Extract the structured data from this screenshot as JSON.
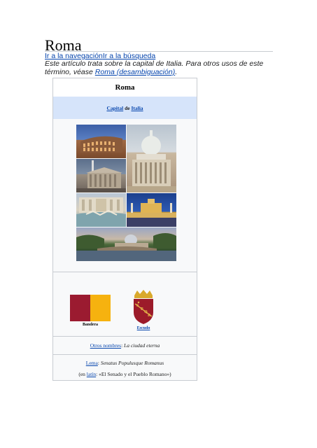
{
  "page": {
    "title": "Roma",
    "skip_nav": "Ir a la navegación",
    "skip_search": "Ir a la búsqueda",
    "hatnote_text": "Este artículo trata sobre la capital de Italia. Para otros usos de este término, véase ",
    "hatnote_link": "Roma (desambiguación)",
    "hatnote_end": "."
  },
  "infobox": {
    "title": "Roma",
    "capital_link": "Capital",
    "capital_de": " de ",
    "capital_country": "Italia",
    "flag_caption": "Bandera",
    "coat_caption": "Escudo",
    "nickname_label": "Otros nombres",
    "nickname_value": "La ciudad eterna",
    "motto_label": "Lema",
    "motto_value": "Senatus Populusque Romanus",
    "motto_translation_prefix": "(en ",
    "motto_translation_lang": "latín",
    "motto_translation_text": ": «El Senado y el Pueblo Romano»)",
    "colon": ": "
  },
  "colors": {
    "flag_red": "#9b1b30",
    "flag_gold": "#f6b20f",
    "capital_row_bg": "#d6e4fa",
    "link": "#0645ad"
  }
}
